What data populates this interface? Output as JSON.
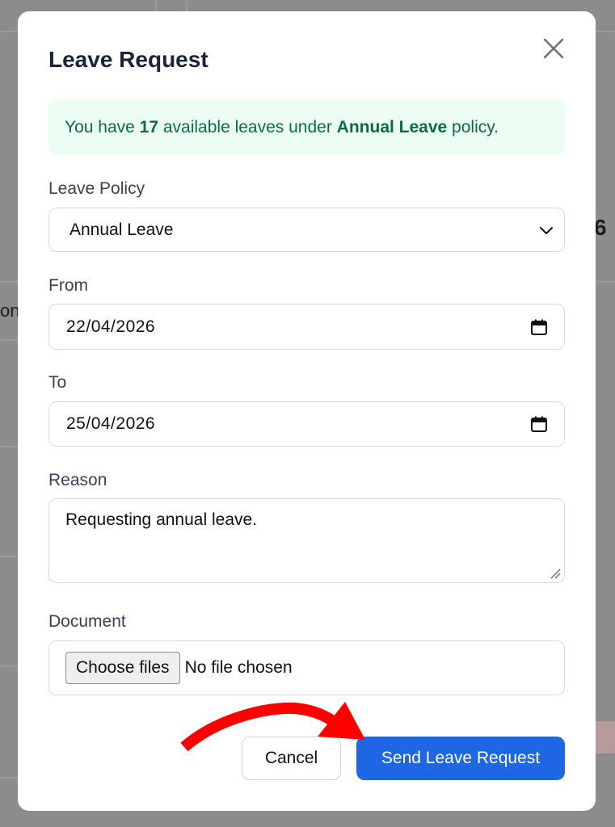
{
  "background": {
    "partial_text_left": "on",
    "partial_text_right": "6"
  },
  "modal": {
    "title": "Leave Request",
    "close_icon": "close-icon",
    "alert": {
      "prefix": "You have ",
      "count": "17",
      "middle": " available leaves under ",
      "policy": "Annual Leave",
      "suffix": " policy."
    },
    "leave_policy": {
      "label": "Leave Policy",
      "value": "Annual Leave",
      "icon": "chevron-down-icon"
    },
    "from": {
      "label": "From",
      "value": "22/04/2026",
      "icon": "calendar-icon"
    },
    "to": {
      "label": "To",
      "value": "25/04/2026",
      "icon": "calendar-icon"
    },
    "reason": {
      "label": "Reason",
      "value": "Requesting annual leave."
    },
    "document": {
      "label": "Document",
      "button_label": "Choose files",
      "status": "No file chosen"
    },
    "buttons": {
      "cancel_label": "Cancel",
      "send_label": "Send Leave Request"
    }
  },
  "colors": {
    "accent": "#1f66e5",
    "alert_bg": "#ecfdf3",
    "alert_text": "#0e6b46",
    "annotation_arrow": "#ff0000"
  }
}
